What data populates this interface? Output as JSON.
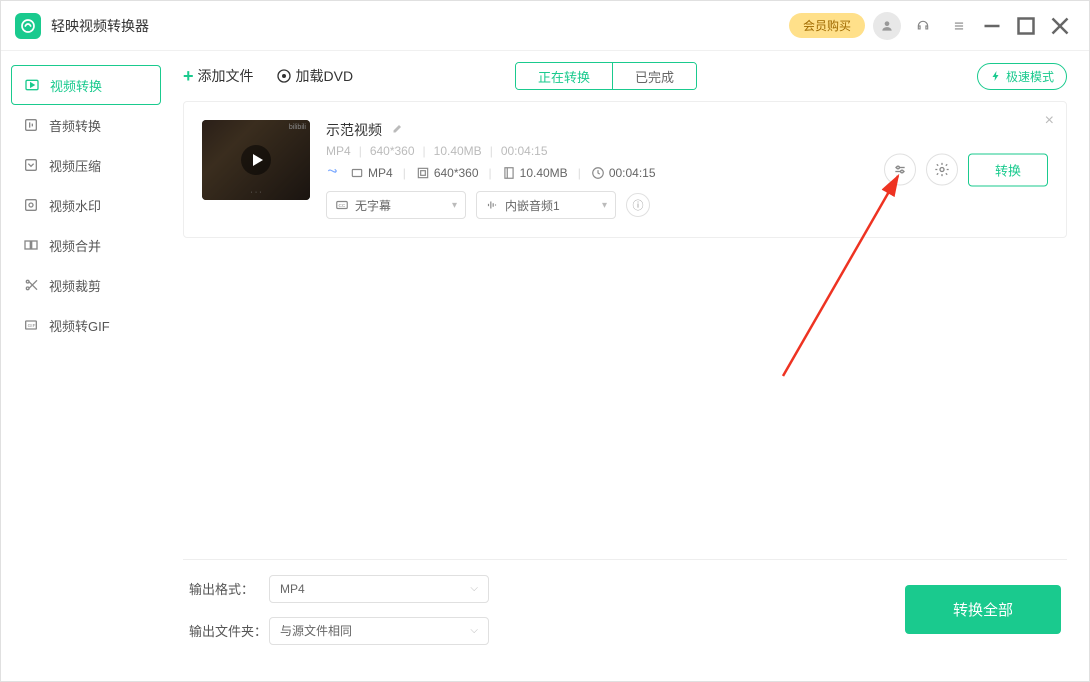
{
  "appTitle": "轻映视频转换器",
  "vip": "会员购买",
  "sidebar": {
    "items": [
      {
        "label": "视频转换"
      },
      {
        "label": "音频转换"
      },
      {
        "label": "视频压缩"
      },
      {
        "label": "视频水印"
      },
      {
        "label": "视频合并"
      },
      {
        "label": "视频裁剪"
      },
      {
        "label": "视频转GIF"
      }
    ]
  },
  "toolbar": {
    "addFile": "添加文件",
    "loadDvd": "加载DVD",
    "tabConverting": "正在转换",
    "tabDone": "已完成",
    "turbo": "极速模式"
  },
  "item": {
    "title": "示范视频",
    "srcFormat": "MP4",
    "srcRes": "640*360",
    "srcSize": "10.40MB",
    "srcDur": "00:04:15",
    "outFormat": "MP4",
    "outRes": "640*360",
    "outSize": "10.40MB",
    "outDur": "00:04:15",
    "subtitle": "无字幕",
    "audio": "内嵌音频1",
    "convert": "转换"
  },
  "footer": {
    "outFormatLabel": "输出格式：",
    "outFormatValue": "MP4",
    "outDirLabel": "输出文件夹：",
    "outDirValue": "与源文件相同",
    "convertAll": "转换全部"
  }
}
